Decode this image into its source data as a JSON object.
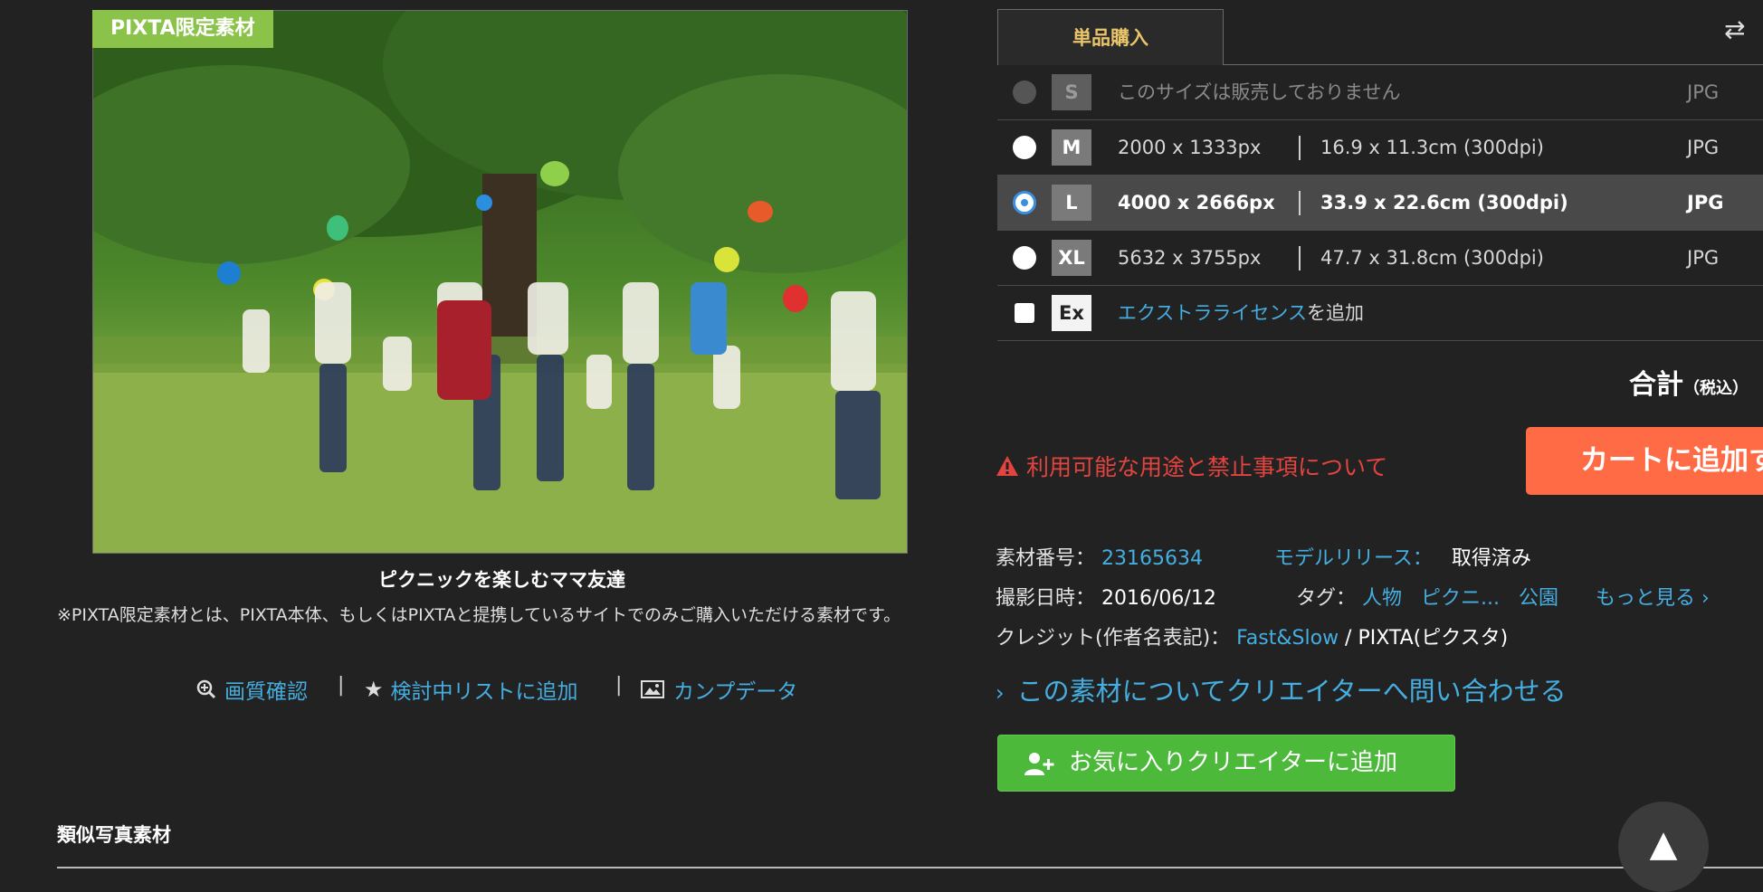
{
  "photo": {
    "badge": "PIXTA限定素材",
    "caption": "ピクニックを楽しむママ友達",
    "notice": "※PIXTA限定素材とは、PIXTA本体、もしくはPIXTAと提携しているサイトでのみご購入いただける素材です。"
  },
  "tools": {
    "zoom_label": "画質確認",
    "favorite_label": "検討中リストに追加",
    "comp_label": "カンプデータ",
    "separator": "|"
  },
  "purchase": {
    "tab_label": "単品購入",
    "swap_icon": "⇄",
    "sizes": [
      {
        "size": "S",
        "unavailable_text": "このサイズは販売しておりません",
        "format": "JPG",
        "state": "disabled"
      },
      {
        "size": "M",
        "px": "2000 x 1333px",
        "cm": "16.9 x 11.3cm (300dpi)",
        "format": "JPG",
        "state": "unselected"
      },
      {
        "size": "L",
        "px": "4000 x 2666px",
        "cm": "33.9 x 22.6cm (300dpi)",
        "format": "JPG",
        "state": "selected"
      },
      {
        "size": "XL",
        "px": "5632 x 3755px",
        "cm": "47.7 x 31.8cm (300dpi)",
        "format": "JPG",
        "state": "unselected"
      }
    ],
    "extra": {
      "box": "Ex",
      "link": "エクストラライセンス",
      "suffix": "を追加"
    },
    "total_label": "合計",
    "tax_label": "（税込）",
    "warning": "利用可能な用途と禁止事項について",
    "cart_button": "カートに追加す"
  },
  "meta": {
    "id_label": "素材番号：",
    "id_value": "23165634",
    "model_label": "モデルリリース：",
    "model_value": "取得済み",
    "date_label": "撮影日時：",
    "date_value": "2016/06/12",
    "tag_label": "タグ：",
    "tags": [
      "人物",
      "ピクニ...",
      "公園"
    ],
    "more_label": "もっと見る ›",
    "credit_label": "クレジット(作者名表記)：",
    "credit_author": "Fast&Slow",
    "credit_suffix": " / PIXTA(ピクスタ)"
  },
  "inquiry_link": "この素材についてクリエイターへ問い合わせる",
  "fav_creator_button": "お気に入りクリエイターに追加",
  "similar_title": "類似写真素材",
  "scroll_top": "▲",
  "colors": {
    "link": "#45aee0",
    "cart": "#ff6b45",
    "fav": "#4cb93b",
    "warning": "#e3443f",
    "tab_text": "#e9c46a"
  }
}
